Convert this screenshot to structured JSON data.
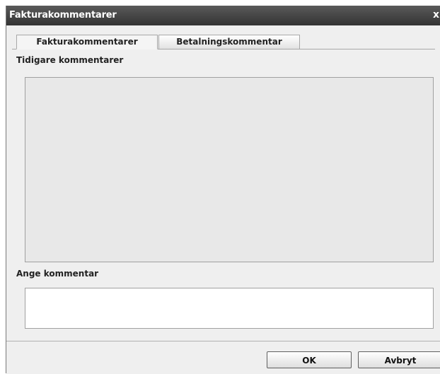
{
  "dialog": {
    "title": "Fakturakommentarer",
    "close_label": "x"
  },
  "tabs": [
    {
      "label": "Fakturakommentarer",
      "active": true
    },
    {
      "label": "Betalningskommentar",
      "active": false
    }
  ],
  "previous_comments": {
    "label": "Tidigare kommentarer"
  },
  "new_comment": {
    "label": "Ange kommentar",
    "value": ""
  },
  "buttons": {
    "ok_label": "OK",
    "cancel_label": "Avbryt"
  }
}
